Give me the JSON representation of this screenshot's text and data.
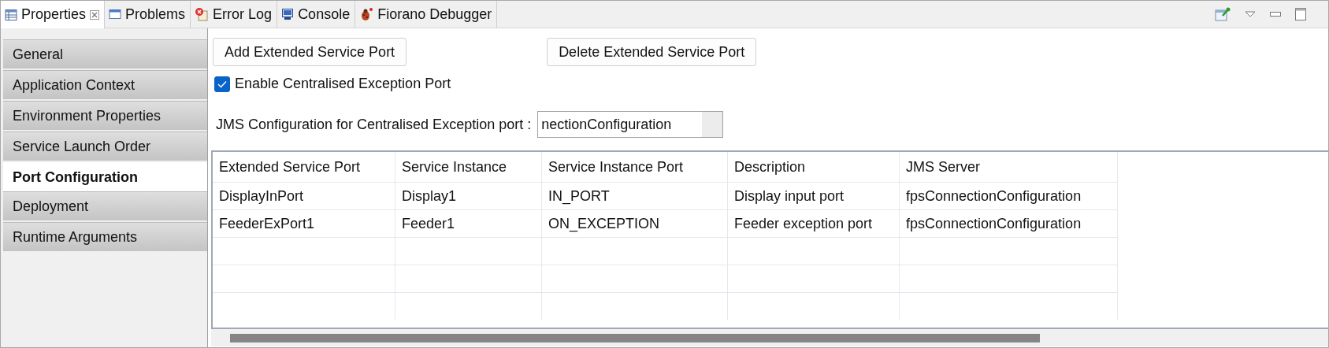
{
  "tabs": [
    {
      "label": "Properties",
      "selected": true
    },
    {
      "label": "Problems",
      "selected": false
    },
    {
      "label": "Error Log",
      "selected": false
    },
    {
      "label": "Console",
      "selected": false
    },
    {
      "label": "Fiorano Debugger",
      "selected": false
    }
  ],
  "sidebar": {
    "items": [
      {
        "label": "General",
        "selected": false
      },
      {
        "label": "Application Context",
        "selected": false
      },
      {
        "label": "Environment Properties",
        "selected": false
      },
      {
        "label": "Service Launch Order",
        "selected": false
      },
      {
        "label": "Port Configuration",
        "selected": true
      },
      {
        "label": "Deployment",
        "selected": false
      },
      {
        "label": "Runtime Arguments",
        "selected": false
      }
    ]
  },
  "buttons": [
    "Add Extended Service Port",
    "Delete Extended Service Port"
  ],
  "checkbox": {
    "label": "Enable Centralised Exception Port",
    "checked": true
  },
  "jms_field": {
    "label": "JMS Configuration for Centralised Exception port :",
    "value": "nectionConfiguration"
  },
  "table": {
    "columns": [
      "Extended Service Port",
      "Service Instance",
      "Service Instance Port",
      "Description",
      "JMS Server"
    ],
    "rows": [
      [
        "DisplayInPort",
        "Display1",
        "IN_PORT",
        "Display input port",
        "fpsConnectionConfiguration"
      ],
      [
        "FeederExPort1",
        "Feeder1",
        "ON_EXCEPTION",
        "Feeder exception port",
        "fpsConnectionConfiguration"
      ]
    ]
  }
}
